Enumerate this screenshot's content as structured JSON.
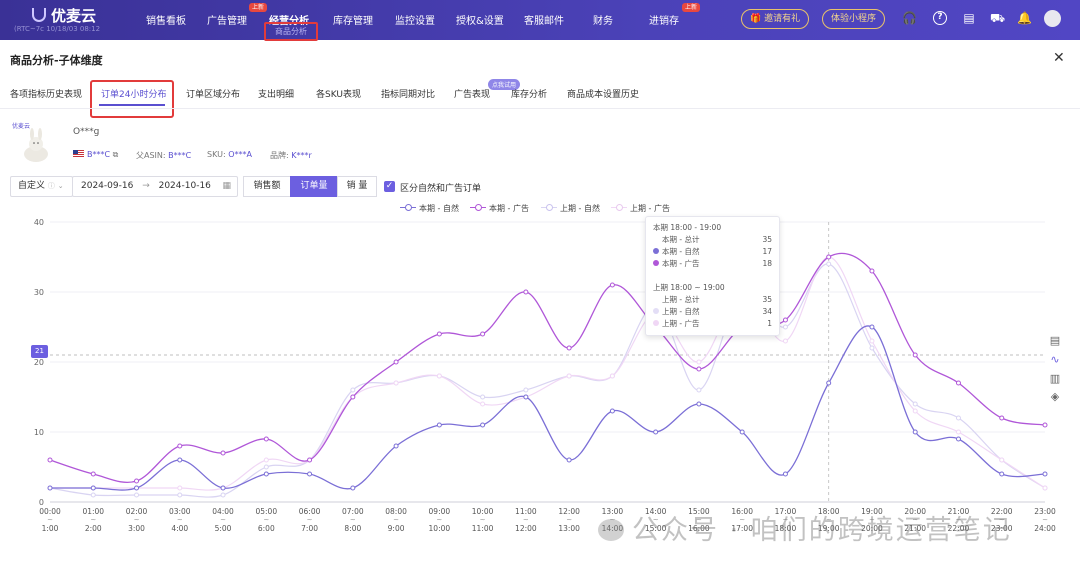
{
  "nav": {
    "logo": "优麦云",
    "account": "(RTC~7c 10/18/03 08:12",
    "items": [
      "销售看板",
      "广告管理",
      "经营分析",
      "库存管理",
      "监控设置",
      "授权&设置",
      "客服邮件",
      "财务",
      "进销存"
    ],
    "new_badge": "上新",
    "active_sub": "商品分析",
    "invite": "邀请有礼",
    "miniprogram": "体验小程序"
  },
  "panel": {
    "title": "商品分析-子体维度",
    "tabs": [
      "各项指标历史表现",
      "订单24小时分布",
      "订单区域分布",
      "支出明细",
      "各SKU表现",
      "指标同期对比",
      "广告表现",
      "库存分析",
      "商品成本设置历史"
    ],
    "tab_badge": "点我试用"
  },
  "product": {
    "brand_logo": "优麦云",
    "name": "O***g",
    "asin": "B***C",
    "parent_asin_label": "父ASIN:",
    "parent_asin": "B***C",
    "sku_label": "SKU:",
    "sku": "O***A",
    "brand_label": "品牌:",
    "brand": "K***r"
  },
  "controls": {
    "range_mode": "自定义",
    "start_date": "2024-09-16",
    "end_date": "2024-10-16",
    "arrow": "→",
    "metrics": [
      "销售额",
      "订单量",
      "销 量"
    ],
    "active_metric": "订单量",
    "split_label": "区分自然和广告订单"
  },
  "colors": {
    "cur_nat": "#7b6fd6",
    "cur_ad": "#b057d8",
    "prev_nat": "#d9d4f2",
    "prev_ad": "#f0d7f5"
  },
  "tooltip": {
    "cur_title": "本期 18:00 - 19:00",
    "cur_total_label": "本期 - 总计",
    "cur_total": "35",
    "cur_nat_label": "本期 - 自然",
    "cur_nat": "17",
    "cur_ad_label": "本期 - 广告",
    "cur_ad": "18",
    "prev_title": "上期 18:00 ~ 19:00",
    "prev_total_label": "上期 - 总计",
    "prev_total": "35",
    "prev_nat_label": "上期 - 自然",
    "prev_nat": "34",
    "prev_ad_label": "上期 - 广告",
    "prev_ad": "1"
  },
  "marker_value": "21",
  "watermark": "公众号 · 咱们的跨境运营笔记",
  "chart_data": {
    "type": "line",
    "ylim": [
      0,
      40
    ],
    "yticks": [
      0,
      10,
      20,
      30,
      40
    ],
    "x": [
      "00:00",
      "01:00",
      "02:00",
      "03:00",
      "04:00",
      "05:00",
      "06:00",
      "07:00",
      "08:00",
      "09:00",
      "10:00",
      "11:00",
      "12:00",
      "13:00",
      "14:00",
      "15:00",
      "16:00",
      "17:00",
      "18:00",
      "19:00",
      "20:00",
      "21:00",
      "22:00",
      "23:00"
    ],
    "x_end": [
      "1:00",
      "2:00",
      "3:00",
      "4:00",
      "5:00",
      "6:00",
      "7:00",
      "8:00",
      "9:00",
      "10:00",
      "11:00",
      "12:00",
      "13:00",
      "14:00",
      "15:00",
      "16:00",
      "17:00",
      "18:00",
      "19:00",
      "20:00",
      "21:00",
      "22:00",
      "23:00",
      "24:00"
    ],
    "series": [
      {
        "name": "本期 - 自然",
        "values": [
          2,
          2,
          2,
          6,
          2,
          4,
          4,
          2,
          8,
          11,
          11,
          15,
          6,
          13,
          10,
          14,
          10,
          4,
          17,
          25,
          10,
          9,
          4,
          4
        ]
      },
      {
        "name": "本期 - 广告",
        "values": [
          6,
          4,
          3,
          8,
          7,
          9,
          6,
          15,
          20,
          24,
          24,
          30,
          22,
          31,
          25,
          19,
          25,
          26,
          35,
          33,
          21,
          17,
          12,
          11
        ]
      },
      {
        "name": "上期 - 自然",
        "values": [
          2,
          1,
          1,
          1,
          1,
          5,
          6,
          16,
          17,
          18,
          15,
          16,
          18,
          18,
          28,
          16,
          30,
          25,
          34,
          22,
          14,
          12,
          6,
          2
        ]
      },
      {
        "name": "上期 - 广告",
        "values": [
          2,
          2,
          2,
          2,
          2,
          6,
          6,
          15,
          17,
          18,
          14,
          15,
          18,
          18,
          27,
          20,
          30,
          23,
          35,
          23,
          13,
          10,
          6,
          2
        ]
      }
    ],
    "reference_line": 21,
    "hover_index": 18
  }
}
